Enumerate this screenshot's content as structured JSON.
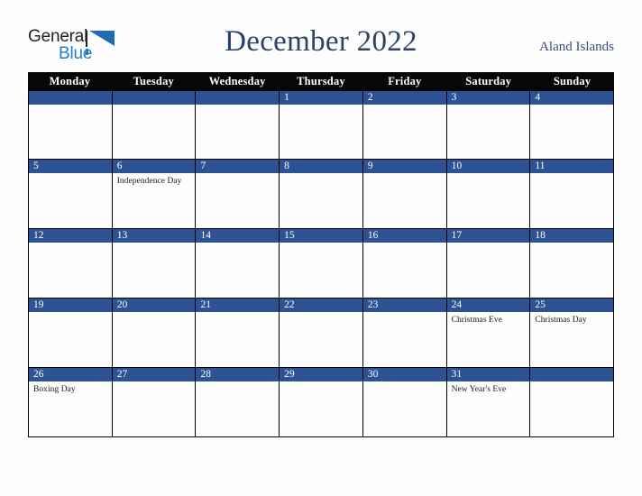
{
  "brand": {
    "name_part1": "General",
    "name_part2": "Blue",
    "mark_icon": "triangle-logo-icon",
    "blue": "#1f6cb5",
    "dark": "#231f20"
  },
  "header": {
    "title": "December 2022",
    "locale": "Aland Islands",
    "title_color": "#2b4268",
    "locale_color": "#3a4f73"
  },
  "calendar": {
    "accent_blue": "#2e5394",
    "header_bg": "#070707",
    "weekdays": [
      "Monday",
      "Tuesday",
      "Wednesday",
      "Thursday",
      "Friday",
      "Saturday",
      "Sunday"
    ],
    "weeks": [
      {
        "days": [
          {
            "number": "",
            "event": ""
          },
          {
            "number": "",
            "event": ""
          },
          {
            "number": "",
            "event": ""
          },
          {
            "number": "1",
            "event": ""
          },
          {
            "number": "2",
            "event": ""
          },
          {
            "number": "3",
            "event": ""
          },
          {
            "number": "4",
            "event": ""
          }
        ]
      },
      {
        "days": [
          {
            "number": "5",
            "event": ""
          },
          {
            "number": "6",
            "event": "Independence Day"
          },
          {
            "number": "7",
            "event": ""
          },
          {
            "number": "8",
            "event": ""
          },
          {
            "number": "9",
            "event": ""
          },
          {
            "number": "10",
            "event": ""
          },
          {
            "number": "11",
            "event": ""
          }
        ]
      },
      {
        "days": [
          {
            "number": "12",
            "event": ""
          },
          {
            "number": "13",
            "event": ""
          },
          {
            "number": "14",
            "event": ""
          },
          {
            "number": "15",
            "event": ""
          },
          {
            "number": "16",
            "event": ""
          },
          {
            "number": "17",
            "event": ""
          },
          {
            "number": "18",
            "event": ""
          }
        ]
      },
      {
        "days": [
          {
            "number": "19",
            "event": ""
          },
          {
            "number": "20",
            "event": ""
          },
          {
            "number": "21",
            "event": ""
          },
          {
            "number": "22",
            "event": ""
          },
          {
            "number": "23",
            "event": ""
          },
          {
            "number": "24",
            "event": "Christmas Eve"
          },
          {
            "number": "25",
            "event": "Christmas Day"
          }
        ]
      },
      {
        "days": [
          {
            "number": "26",
            "event": "Boxing Day"
          },
          {
            "number": "27",
            "event": ""
          },
          {
            "number": "28",
            "event": ""
          },
          {
            "number": "29",
            "event": ""
          },
          {
            "number": "30",
            "event": ""
          },
          {
            "number": "31",
            "event": "New Year's Eve"
          },
          {
            "number": "",
            "event": ""
          }
        ]
      }
    ]
  }
}
